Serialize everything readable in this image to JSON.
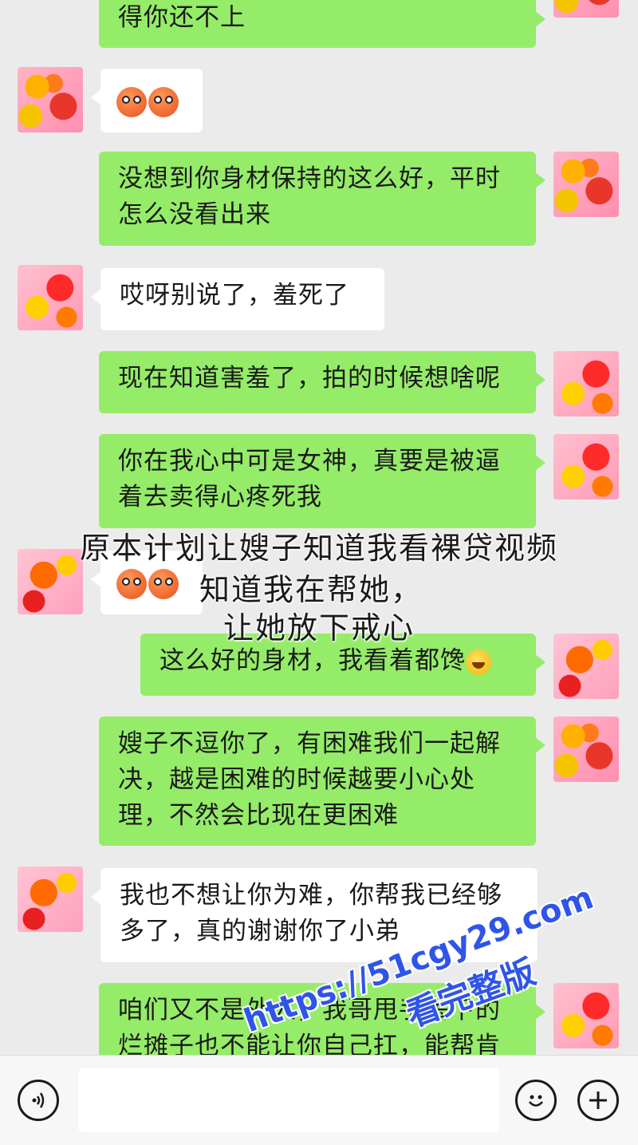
{
  "messages": [
    {
      "side": "me",
      "text": "得你还不上"
    },
    {
      "side": "them",
      "text": ""
    },
    {
      "side": "me",
      "lines": [
        "没想到你身材保持的这么好，平时",
        "怎么没看出来"
      ]
    },
    {
      "side": "them",
      "text": "哎呀别说了，羞死了"
    },
    {
      "side": "me",
      "text": "现在知道害羞了，拍的时候想啥呢"
    },
    {
      "side": "me",
      "lines": [
        "你在我心中可是女神，真要是被逼",
        "着去卖得心疼死我"
      ]
    },
    {
      "side": "them",
      "text": ""
    },
    {
      "side": "me",
      "text": "这么好的身材，我看着都馋"
    },
    {
      "side": "me",
      "lines": [
        "嫂子不逗你了，有困难我们一起解",
        "决，越是困难的时候越要小心处",
        "理，不然会比现在更困难"
      ]
    },
    {
      "side": "them",
      "lines": [
        "我也不想让你为难，你帮我已经够",
        "多了，真的谢谢你了小弟"
      ]
    },
    {
      "side": "me",
      "lines": [
        "咱们又不是外人，我哥甩手丢下的",
        "烂摊子也不能让你自己扛，能帮肯"
      ]
    }
  ],
  "overlay": {
    "line1": "原本计划让嫂子知道我看裸贷视频",
    "line2": "知道我在帮她，",
    "line3": "让她放下戒心"
  },
  "watermark": {
    "url": "https://51cgy29.com",
    "tag": "看完整版"
  },
  "icons": {
    "voice": "voice-icon",
    "emoji": "emoji-icon",
    "plus": "plus-icon"
  }
}
